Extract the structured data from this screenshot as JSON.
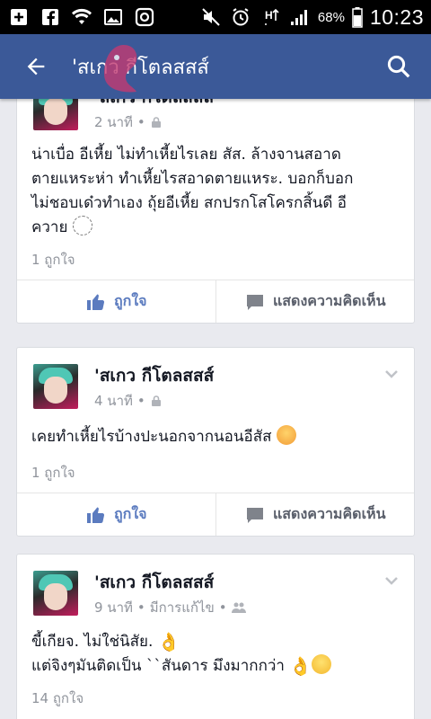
{
  "status_bar": {
    "icons": [
      "add-box-icon",
      "facebook-icon",
      "wifi-icon",
      "image-icon",
      "instagram-icon",
      "mute-icon",
      "alarm-icon",
      "data-icon",
      "signal-icon"
    ],
    "battery": "68%",
    "time": "10:23"
  },
  "appbar": {
    "title": "'สเกว กีโตลสสส์",
    "back_icon": "arrow-left-icon",
    "search_icon": "search-icon",
    "color": "#3b5998"
  },
  "posts": [
    {
      "author": "'สเกว กีโตลสสส์",
      "time": "2 นาที",
      "privacy_icon": "lock-icon",
      "text_lines": [
        "น่าเบื่อ อีเหี้ย ไม่ทำเหี้ยไรเลย สัส. ล้างจานสอาด",
        "ตายแหระห่า ทำเหี้ยไรสอาดตายแหระ. บอกก็บอก",
        "ไม่ชอบเด๋วทำเอง ถุ้ยอีเหี้ย สกปรกโสโครกสิ้นดี อี",
        "ควาย"
      ],
      "likes": "1 ถูกใจ",
      "like_label": "ถูกใจ",
      "comment_label": "แสดงความคิดเห็น"
    },
    {
      "author": "'สเกว กีโตลสสส์",
      "time": "4 นาที",
      "privacy_icon": "lock-icon",
      "text_lines": [
        "เคยทำเหี้ยไรบ้างปะนอกจากนอนอีสัส"
      ],
      "likes": "1 ถูกใจ",
      "like_label": "ถูกใจ",
      "comment_label": "แสดงความคิดเห็น"
    },
    {
      "author": "'สเกว กีโตลสสส์",
      "time": "9 นาที",
      "edited": "มีการแก้ไข",
      "privacy_icon": "friends-icon",
      "text_lines": [
        "ขี้เกียจ. ไม่ใช่นิสัย.",
        "แต่จิงๆมันติดเป็น ``สันดาร มึงมากกว่า"
      ],
      "likes": "14 ถูกใจ"
    }
  ]
}
